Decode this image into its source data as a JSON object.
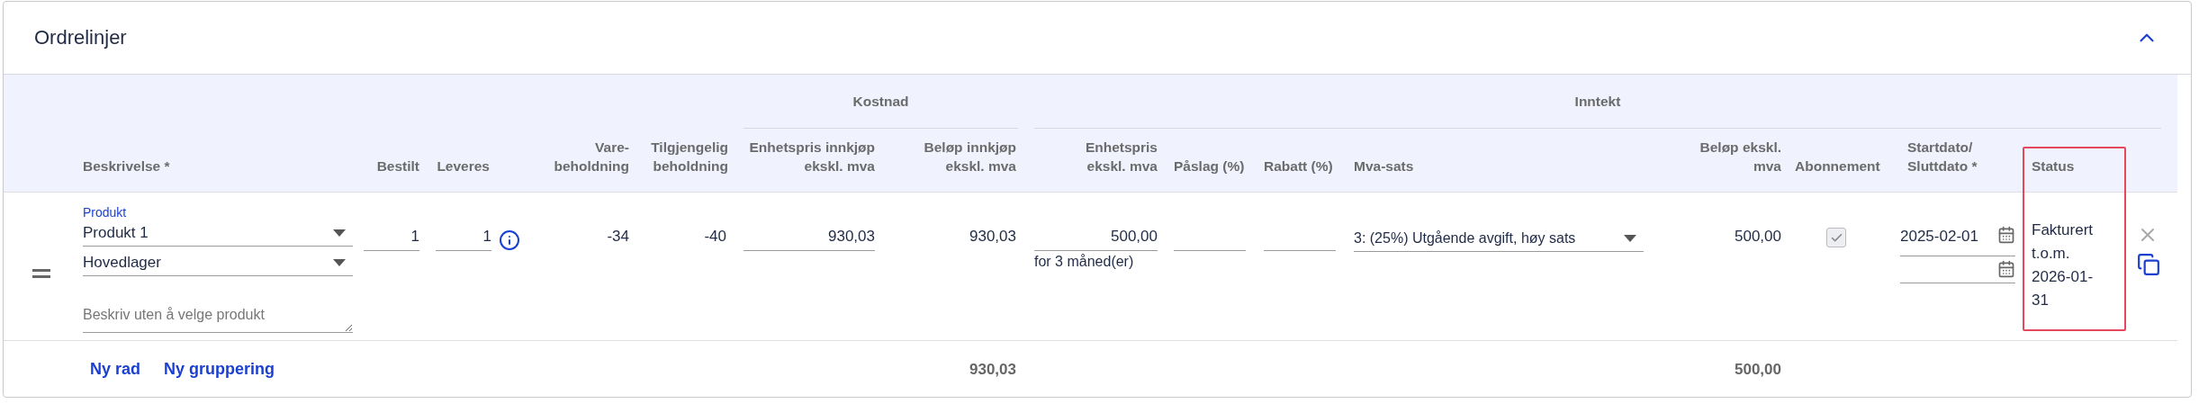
{
  "panel": {
    "title": "Ordrelinjer",
    "expanded": true
  },
  "column_groups": [
    {
      "label": "Kostnad",
      "kind": "cost"
    },
    {
      "label": "Inntekt",
      "kind": "income"
    }
  ],
  "columns": [
    {
      "label": "Beskrivelse *",
      "highlighted": false
    },
    {
      "label": "Bestilt",
      "highlighted": false
    },
    {
      "label": "Leveres",
      "highlighted": false
    },
    {
      "label": "Vare- beholdning",
      "highlighted": false
    },
    {
      "label": "Tilgjengelig beholdning",
      "highlighted": false
    },
    {
      "label": "Enhetspris innkjøp ekskl. mva",
      "highlighted": false
    },
    {
      "label": "Beløp innkjøp ekskl. mva",
      "highlighted": false
    },
    {
      "label": "Enhetspris ekskl. mva",
      "highlighted": false
    },
    {
      "label": "Påslag (%)",
      "highlighted": false
    },
    {
      "label": "Rabatt (%)",
      "highlighted": false
    },
    {
      "label": "Mva-sats",
      "highlighted": false
    },
    {
      "label": "Beløp ekskl. mva",
      "highlighted": false
    },
    {
      "label": "Abonnement",
      "highlighted": false
    },
    {
      "label": "Startdato/ Sluttdato *",
      "highlighted": false
    },
    {
      "label": "Status",
      "highlighted": true
    }
  ],
  "line": {
    "product_label": "Produkt",
    "product": "Produkt 1",
    "warehouse": "Hovedlager",
    "description_placeholder": "Beskriv uten å velge produkt",
    "ordered": "1",
    "delivered": "1",
    "stock": "-34",
    "available": "-40",
    "unit_cost": "930,03",
    "cost_amount": "930,03",
    "unit_price": "500,00",
    "price_note": "for 3 måned(er)",
    "vat": "3: (25%) Utgående avgift, høy sats",
    "amount": "500,00",
    "subscription": {
      "checked": true,
      "disabled": true
    },
    "start_date": "2025-02-01",
    "status": "Fakturert t.o.m. 2026-01-31"
  },
  "footer": {
    "links": [
      "Ny rad",
      "Ny gruppering"
    ],
    "cost_total": "930,03",
    "income_total": "500,00"
  }
}
